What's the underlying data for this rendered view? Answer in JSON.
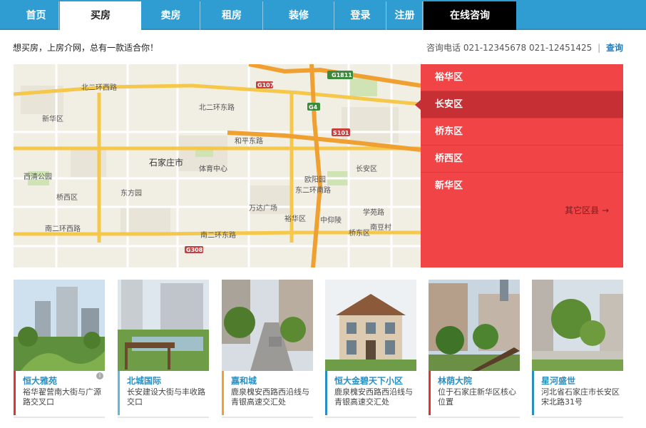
{
  "nav": {
    "items": [
      {
        "label": "首页"
      },
      {
        "label": "买房"
      },
      {
        "label": "卖房"
      },
      {
        "label": "租房"
      },
      {
        "label": "装修"
      },
      {
        "label": "登录"
      },
      {
        "label": "注册"
      },
      {
        "label": "在线咨询"
      }
    ],
    "active_index": 1
  },
  "header": {
    "slogan": "想买房，上房介网，总有一款适合你！",
    "hotline": "咨询电话 021-12345678 021-12451425",
    "separator": "|",
    "query_label": "查询"
  },
  "map": {
    "labels": [
      "石家庄市",
      "新华区",
      "长安区",
      "桥西区",
      "桥东区",
      "裕华区",
      "北二环西路",
      "北二环东路",
      "南二环西路",
      "南二环东路",
      "东二环南路",
      "体育中心",
      "欧阳园",
      "东方园",
      "西清公园",
      "学苑路",
      "南豆村",
      "中仰陵",
      "万达广场",
      "和平东路"
    ],
    "badges": [
      "G1811",
      "G107",
      "G4",
      "S101",
      "G308"
    ]
  },
  "districts": {
    "items": [
      {
        "label": "裕华区"
      },
      {
        "label": "长安区"
      },
      {
        "label": "桥东区"
      },
      {
        "label": "桥西区"
      },
      {
        "label": "新华区"
      }
    ],
    "active_index": 1,
    "other_label": "其它区县 →"
  },
  "cards": [
    {
      "name": "恒大雅苑",
      "address": "裕华翟营南大街与广源路交叉口",
      "accent": "#e3332f",
      "info_icon": "i"
    },
    {
      "name": "北城国际",
      "address": "长安建设大街与丰收路交口",
      "accent": "#5fb8e0"
    },
    {
      "name": "嘉和城",
      "address": "鹿泉槐安西路西沿线与青银高速交汇处",
      "accent": "#f0a030"
    },
    {
      "name": "恒大金碧天下小区",
      "address": "鹿泉槐安西路西沿线与青银高速交汇处",
      "accent": "#2a8ec0"
    },
    {
      "name": "林荫大院",
      "address": "位于石家庄新华区核心位置",
      "accent": "#e3332f"
    },
    {
      "name": "星河盛世",
      "address": "河北省石家庄市长安区宋北路31号",
      "accent": "#2a8ec0"
    }
  ]
}
